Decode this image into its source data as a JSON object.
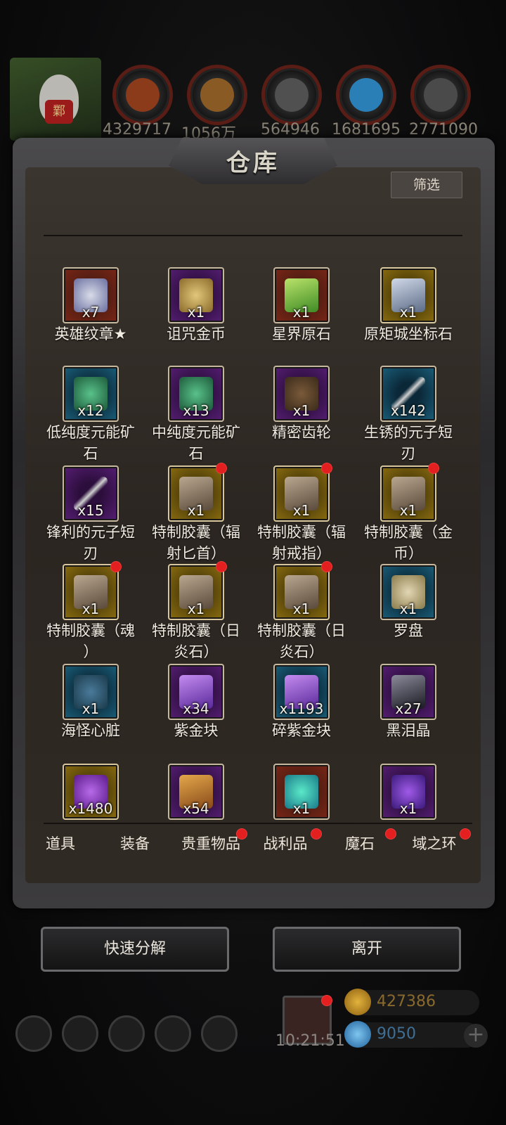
{
  "resources": [
    {
      "icon": "meat-icon",
      "value": "4329717"
    },
    {
      "icon": "wood-icon",
      "value": "1056万"
    },
    {
      "icon": "stone-icon",
      "value": "564946"
    },
    {
      "icon": "crystal-icon",
      "value": "1681695"
    },
    {
      "icon": "iron-icon",
      "value": "2771090"
    }
  ],
  "avatar": {
    "seal_text": "鄴"
  },
  "warehouse": {
    "title": "仓库",
    "filter_label": "筛选"
  },
  "items": [
    {
      "name_1": "英雄纹章★",
      "name_2": "",
      "qty": "x7",
      "rarity": "red",
      "art": "badge-icon",
      "dot": false
    },
    {
      "name_1": "诅咒金币",
      "name_2": "",
      "qty": "x1",
      "rarity": "purple",
      "art": "coin-icon",
      "dot": false
    },
    {
      "name_1": "星界原石",
      "name_2": "",
      "qty": "x1",
      "rarity": "red",
      "art": "green-crystal-icon",
      "dot": false
    },
    {
      "name_1": "原矩城坐标石",
      "name_2": "",
      "qty": "x1",
      "rarity": "gold",
      "art": "cube-icon",
      "dot": false
    },
    {
      "name_1": "低纯度元能矿",
      "name_2": "石",
      "qty": "x12",
      "rarity": "blue",
      "art": "ore-icon",
      "dot": false
    },
    {
      "name_1": "中纯度元能矿",
      "name_2": "石",
      "qty": "x13",
      "rarity": "purple",
      "art": "ore-icon",
      "dot": false
    },
    {
      "name_1": "精密齿轮",
      "name_2": "",
      "qty": "x1",
      "rarity": "purple",
      "art": "gear-icon",
      "dot": false
    },
    {
      "name_1": "生锈的元子短",
      "name_2": "刃",
      "qty": "x142",
      "rarity": "blue",
      "art": "blade-icon",
      "dot": false
    },
    {
      "name_1": "锋利的元子短",
      "name_2": "刃",
      "qty": "x15",
      "rarity": "purple",
      "art": "blade-icon",
      "dot": false
    },
    {
      "name_1": "特制胶囊（辐",
      "name_2": "射匕首）",
      "qty": "x1",
      "rarity": "gold",
      "art": "capsule-icon",
      "dot": true
    },
    {
      "name_1": "特制胶囊（辐",
      "name_2": "射戒指）",
      "qty": "x1",
      "rarity": "gold",
      "art": "capsule-icon",
      "dot": true
    },
    {
      "name_1": "特制胶囊（金",
      "name_2": "币）",
      "qty": "x1",
      "rarity": "gold",
      "art": "capsule-icon",
      "dot": true
    },
    {
      "name_1": "特制胶囊（魂",
      "name_2": "）",
      "qty": "x1",
      "rarity": "gold",
      "art": "capsule-icon",
      "dot": true
    },
    {
      "name_1": "特制胶囊（日",
      "name_2": "炎石）",
      "qty": "x1",
      "rarity": "gold",
      "art": "capsule-icon",
      "dot": true
    },
    {
      "name_1": "特制胶囊（日",
      "name_2": "炎石）",
      "qty": "x1",
      "rarity": "gold",
      "art": "capsule-icon",
      "dot": true
    },
    {
      "name_1": "罗盘",
      "name_2": "",
      "qty": "x1",
      "rarity": "blue",
      "art": "compass-icon",
      "dot": false
    },
    {
      "name_1": "海怪心脏",
      "name_2": "",
      "qty": "x1",
      "rarity": "blue",
      "art": "heart-icon",
      "dot": false
    },
    {
      "name_1": "紫金块",
      "name_2": "",
      "qty": "x34",
      "rarity": "purple",
      "art": "purple-crystal-icon",
      "dot": false
    },
    {
      "name_1": "碎紫金块",
      "name_2": "",
      "qty": "x1193",
      "rarity": "blue",
      "art": "purple-crystal-icon",
      "dot": false
    },
    {
      "name_1": "黑泪晶",
      "name_2": "",
      "qty": "x27",
      "rarity": "purple",
      "art": "black-crystal-icon",
      "dot": false
    },
    {
      "name_1": "",
      "name_2": "",
      "qty": "x1480",
      "rarity": "gold",
      "art": "purple-gem-icon",
      "dot": false
    },
    {
      "name_1": "",
      "name_2": "",
      "qty": "x54",
      "rarity": "purple",
      "art": "scroll-icon",
      "dot": false
    },
    {
      "name_1": "",
      "name_2": "",
      "qty": "x1",
      "rarity": "red",
      "art": "potion-icon",
      "dot": false
    },
    {
      "name_1": "",
      "name_2": "",
      "qty": "x1",
      "rarity": "purple",
      "art": "purple-orb-icon",
      "dot": false
    }
  ],
  "tabs": [
    {
      "label": "道具",
      "dot": false
    },
    {
      "label": "装备",
      "dot": false
    },
    {
      "label": "贵重物品",
      "dot": true
    },
    {
      "label": "战利品",
      "dot": true
    },
    {
      "label": "魔石",
      "dot": true
    },
    {
      "label": "域之环",
      "dot": true
    }
  ],
  "buttons": {
    "decompose": "快速分解",
    "leave": "离开"
  },
  "hud": {
    "clock": "10:21:51",
    "gold": "427386",
    "gem": "9050"
  }
}
